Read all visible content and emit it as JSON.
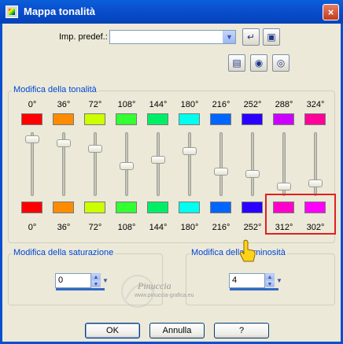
{
  "window": {
    "title": "Mappa tonalità",
    "close_label": "×"
  },
  "preset": {
    "label": "Imp. predef.:",
    "value": ""
  },
  "hue_group": {
    "label": "Modifica della tonalità",
    "top_degrees": [
      "0°",
      "36°",
      "72°",
      "108°",
      "144°",
      "180°",
      "216°",
      "252°",
      "288°",
      "324°"
    ],
    "bottom_degrees": [
      "0°",
      "36°",
      "72°",
      "108°",
      "144°",
      "180°",
      "216°",
      "252°",
      "312°",
      "302°"
    ],
    "top_colors": [
      "#ff0000",
      "#ff8c00",
      "#ccff00",
      "#33ff33",
      "#00ee66",
      "#00ffee",
      "#0066ff",
      "#2a00ff",
      "#cc00ff",
      "#ff0099"
    ],
    "bottom_colors": [
      "#ff0000",
      "#ff8c00",
      "#ccff00",
      "#33ff33",
      "#00ee66",
      "#00ffee",
      "#0066ff",
      "#2a00ff",
      "#ff00cc",
      "#ff00ff"
    ]
  },
  "saturation": {
    "label": "Modifica della saturazione",
    "value": "0"
  },
  "luminosity": {
    "label": "Modifica della luminosità",
    "value": "4"
  },
  "buttons": {
    "ok": "OK",
    "cancel": "Annulla",
    "help": "?"
  },
  "watermark": {
    "text": "Pinuccia",
    "sub": "www.pinuccia-grafica.eu"
  }
}
